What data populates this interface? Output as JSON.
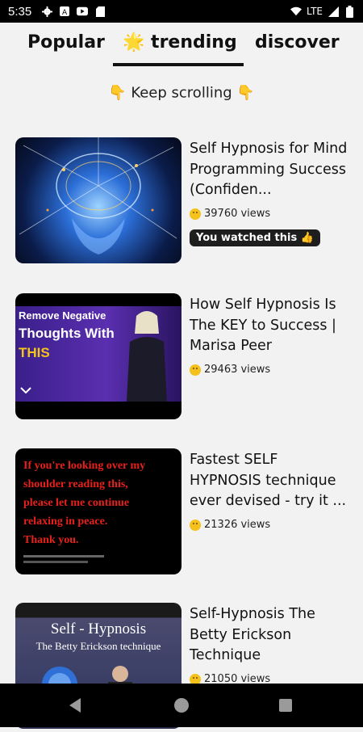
{
  "status_bar": {
    "time": "5:35",
    "network": "LTE"
  },
  "tabs": [
    {
      "label": "Popular",
      "active": false
    },
    {
      "label": "🌟 trending",
      "active": true
    },
    {
      "label": "discover",
      "active": false
    }
  ],
  "hint": {
    "left_emoji": "👇",
    "text": "Keep scrolling",
    "right_emoji": "👇"
  },
  "videos": [
    {
      "title": "Self Hypnosis for Mind Programming Success (Confiden...",
      "views": "39760 views",
      "badge": "You watched this 👍",
      "thumb_text": []
    },
    {
      "title": "How Self Hypnosis Is The KEY to Success | Marisa Peer",
      "views": "29463 views",
      "badge": "",
      "thumb_text": [
        "Remove Negative",
        "Thoughts With",
        "THIS"
      ]
    },
    {
      "title": "Fastest SELF HYPNOSIS technique ever devised - try it ...",
      "views": "21326 views",
      "badge": "",
      "thumb_text": [
        "If you're looking over my",
        "shoulder reading this,",
        "please let me continue",
        "relaxing in peace.",
        "Thank you."
      ]
    },
    {
      "title": "Self-Hypnosis The Betty Erickson Technique",
      "views": "21050 views",
      "badge": "",
      "thumb_text": [
        "Self - Hypnosis",
        "The Betty Erickson technique"
      ]
    }
  ],
  "colors": {
    "background": "#f2f2f2",
    "badge_bg": "#1e1e1e",
    "tab_underline": "#111111"
  }
}
